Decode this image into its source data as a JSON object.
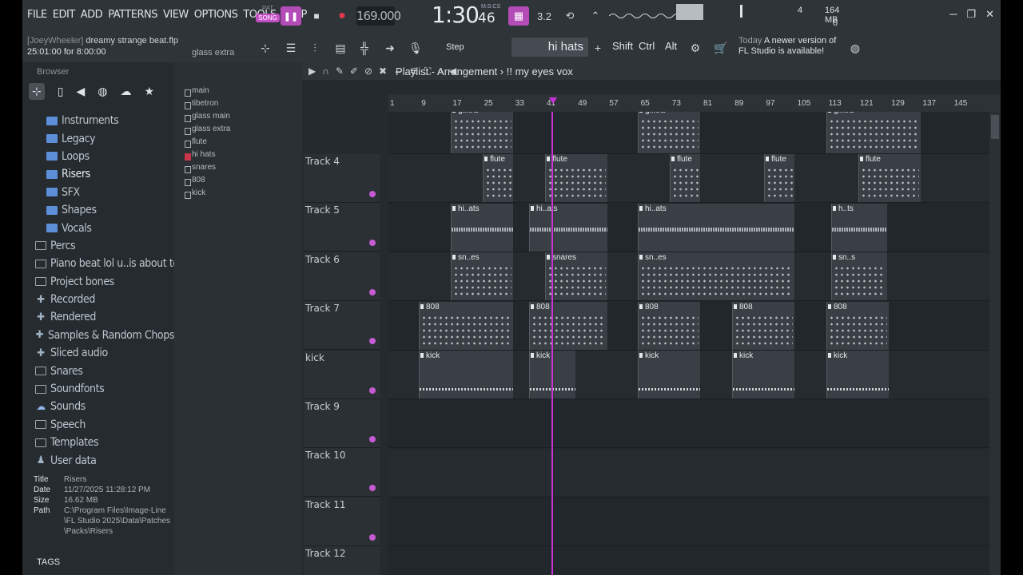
{
  "menu": [
    "FILE",
    "EDIT",
    "ADD",
    "PATTERNS",
    "VIEW",
    "OPTIONS",
    "TOOLS",
    "HELP"
  ],
  "transport": {
    "pat_label": "PAT",
    "song_label": "SONG",
    "tempo": "169.000",
    "time_main": "1:30",
    "time_sub": "46",
    "time_unit": "M:S:CS"
  },
  "monitor": {
    "voices": "4",
    "memory": "164 MB",
    "cpu": "6"
  },
  "project": {
    "user": "[JoeyWheeler]",
    "file": "dreamy strange beat.flp",
    "duration": "25:01:00 for 8:00:00",
    "hint": "glass extra"
  },
  "toolbar": {
    "snap": "Step",
    "pattern": "hi hats",
    "keys": [
      "Shift",
      "Ctrl",
      "Alt"
    ]
  },
  "news": {
    "today": "Today",
    "line1": "A newer version of",
    "line2": "FL Studio is available!"
  },
  "browser": {
    "title": "Browser",
    "items": [
      {
        "label": "Instruments",
        "icon": "folder-pack-icon"
      },
      {
        "label": "Legacy",
        "icon": "folder-pack-icon"
      },
      {
        "label": "Loops",
        "icon": "folder-pack-icon"
      },
      {
        "label": "Risers",
        "icon": "folder-pack-icon"
      },
      {
        "label": "SFX",
        "icon": "folder-pack-icon"
      },
      {
        "label": "Shapes",
        "icon": "folder-pack-icon"
      },
      {
        "label": "Vocals",
        "icon": "folder-pack-icon"
      },
      {
        "label": "Percs",
        "icon": "folder-icon"
      },
      {
        "label": "Piano beat lol u..is about to die",
        "icon": "folder-icon"
      },
      {
        "label": "Project bones",
        "icon": "folder-icon"
      },
      {
        "label": "Recorded",
        "icon": "plus-folder-icon"
      },
      {
        "label": "Rendered",
        "icon": "plus-folder-icon"
      },
      {
        "label": "Samples & Random Chops",
        "icon": "plus-folder-icon"
      },
      {
        "label": "Sliced audio",
        "icon": "plus-folder-icon"
      },
      {
        "label": "Snares",
        "icon": "folder-icon"
      },
      {
        "label": "Soundfonts",
        "icon": "folder-icon"
      },
      {
        "label": "Sounds",
        "icon": "cloud-icon"
      },
      {
        "label": "Speech",
        "icon": "folder-icon"
      },
      {
        "label": "Templates",
        "icon": "folder-icon"
      },
      {
        "label": "User data",
        "icon": "user-icon"
      }
    ],
    "info": {
      "title_label": "Title",
      "title": "Risers",
      "date_label": "Date",
      "date": "11/27/2025 11:28:12 PM",
      "size_label": "Size",
      "size": "16.62 MB",
      "path_label": "Path",
      "path": "C:\\Program Files\\Image-Line\\FL Studio 2025\\Data\\Patches\\Packs\\Risers"
    },
    "tags": "TAGS"
  },
  "picker": [
    "main",
    "tibetron",
    "glass main",
    "glass extra",
    "flute",
    "hi hats",
    "snares",
    "808",
    "kick"
  ],
  "playlist": {
    "title": "Playlist - Arrangement",
    "current": "!! my eyes vox",
    "ruler": [
      "1",
      "9",
      "17",
      "25",
      "33",
      "41",
      "49",
      "57",
      "65",
      "73",
      "81",
      "89",
      "97",
      "105",
      "113",
      "121",
      "129",
      "137",
      "145"
    ],
    "tracks": [
      "Track 4",
      "Track 5",
      "Track 6",
      "Track 7",
      "kick",
      "Track 9",
      "Track 10",
      "Track 11",
      "Track 12"
    ]
  },
  "colors": {
    "accent": "#c832d8",
    "song_active": "#c54fc7",
    "record": "#e03a4a"
  }
}
